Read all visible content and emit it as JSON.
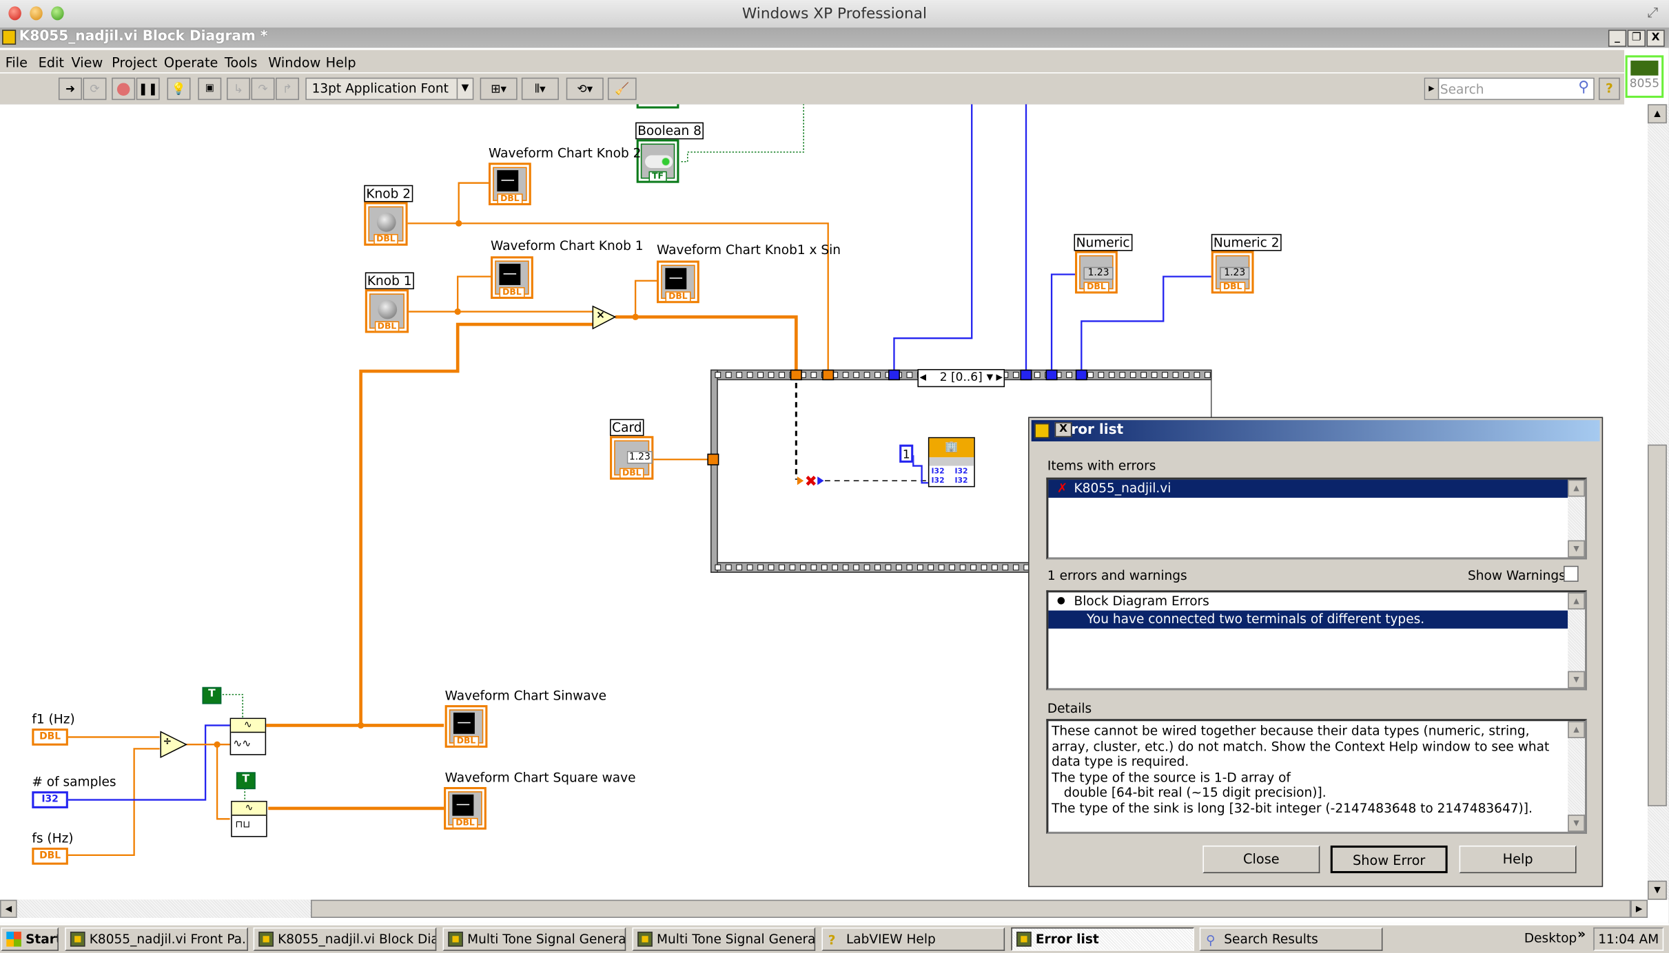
{
  "os_title": "Windows XP Professional",
  "window": {
    "title": "K8055_nadjil.vi Block Diagram *",
    "controls": [
      "_",
      "❐",
      "X"
    ]
  },
  "menu": [
    "File",
    "Edit",
    "View",
    "Project",
    "Operate",
    "Tools",
    "Window",
    "Help"
  ],
  "toolbar": {
    "font_select": "13pt Application Font",
    "search_placeholder": "Search",
    "help": "?",
    "vi_icon_text": "8055"
  },
  "diagram": {
    "labels": {
      "boolean8": "Boolean 8",
      "wf_knob2": "Waveform Chart Knob 2",
      "knob2": "Knob 2",
      "wf_knob1": "Waveform Chart Knob 1",
      "wf_knob1_sin": "Waveform Chart Knob1 x Sin",
      "knob1": "Knob 1",
      "numeric": "Numeric",
      "numeric2": "Numeric 2",
      "card": "Card",
      "f1": "f1 (Hz)",
      "samples": "# of samples",
      "fs": "fs (Hz)",
      "wf_sin": "Waveform Chart Sinwave",
      "wf_square": "Waveform Chart Square wave"
    },
    "type_tags": {
      "dbl": "DBL",
      "i32": "I32",
      "tf": "TF",
      "true_const": "T"
    },
    "numeric_display": "1.23",
    "sequence_selector": "2 [0..6]",
    "constant_one": "1",
    "multiply_symbol": "×",
    "divide_symbol": "÷"
  },
  "error_dialog": {
    "title": "Error list",
    "items_label": "Items with errors",
    "items": [
      "K8055_nadjil.vi"
    ],
    "count_label": "1 errors and warnings",
    "show_warnings_label": "Show Warnings",
    "show_warnings_checked": false,
    "tree_group": "Block Diagram Errors",
    "tree_item": "You have connected two terminals of different types.",
    "details_label": "Details",
    "details": "These cannot be wired together because their data types (numeric, string, array, cluster, etc.) do not match. Show the Context Help window to see what data type is required.\nThe type of the source is 1-D array of\n   double [64-bit real (~15 digit precision)].\nThe type of the sink is long [32-bit integer (-2147483648 to 2147483647)].",
    "buttons": {
      "close": "Close",
      "show_error": "Show Error",
      "help": "Help"
    }
  },
  "taskbar": {
    "start": "Start",
    "tasks": [
      {
        "label": "K8055_nadjil.vi Front Pa...",
        "active": false
      },
      {
        "label": "K8055_nadjil.vi Block Dia...",
        "active": false
      },
      {
        "label": "Multi Tone Signal Genera...",
        "active": false
      },
      {
        "label": "Multi Tone Signal Genera...",
        "active": false
      },
      {
        "label": "LabVIEW Help",
        "active": false
      },
      {
        "label": "Error list",
        "active": true
      },
      {
        "label": "Search Results",
        "active": false
      }
    ],
    "desktop": "Desktop",
    "chevron": "»",
    "clock": "11:04 AM"
  },
  "colors": {
    "dbl_wire": "#f07f00",
    "i32_wire": "#2424f0",
    "bool_wire": "#0a7a1a",
    "selection": "#0a246a"
  }
}
